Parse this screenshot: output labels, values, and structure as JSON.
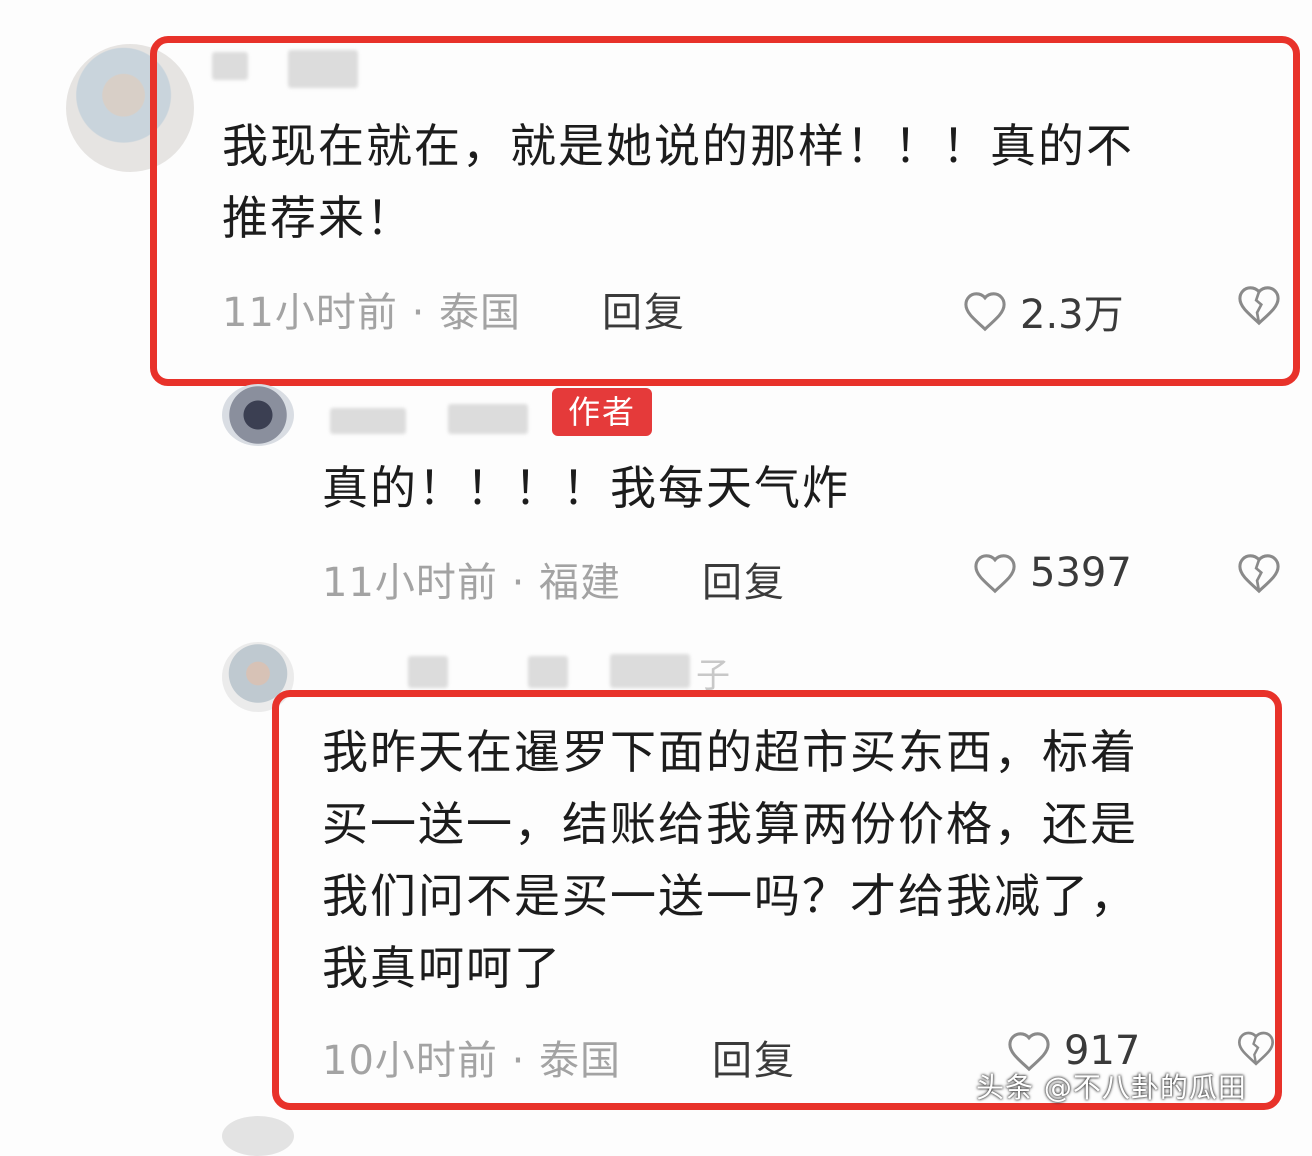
{
  "comments": [
    {
      "name_tail": "",
      "text_lines": [
        "我现在就在，就是她说的那样！！！真的不",
        "推荐来！"
      ],
      "meta": "11小时前 · 泰国",
      "reply": "回复",
      "likes": "2.3万"
    },
    {
      "badge": "作者",
      "text_lines": [
        "真的！！！！我每天气炸"
      ],
      "meta": "11小时前 · 福建",
      "reply": "回复",
      "likes": "5397"
    },
    {
      "name_tail": "子",
      "text_lines": [
        "我昨天在暹罗下面的超市买东西，标着",
        "买一送一，结账给我算两份价格，还是",
        "我们问不是买一送一吗？才给我减了，",
        "我真呵呵了"
      ],
      "meta": "10小时前 · 泰国",
      "reply": "回复",
      "likes": "917"
    }
  ],
  "watermark": "头条 @不八卦的瓜田",
  "colors": {
    "highlight": "#e8322a",
    "badge": "#e53a3a",
    "meta": "#a3a3a3"
  },
  "icons": [
    "heart-outline-icon",
    "broken-heart-icon"
  ]
}
